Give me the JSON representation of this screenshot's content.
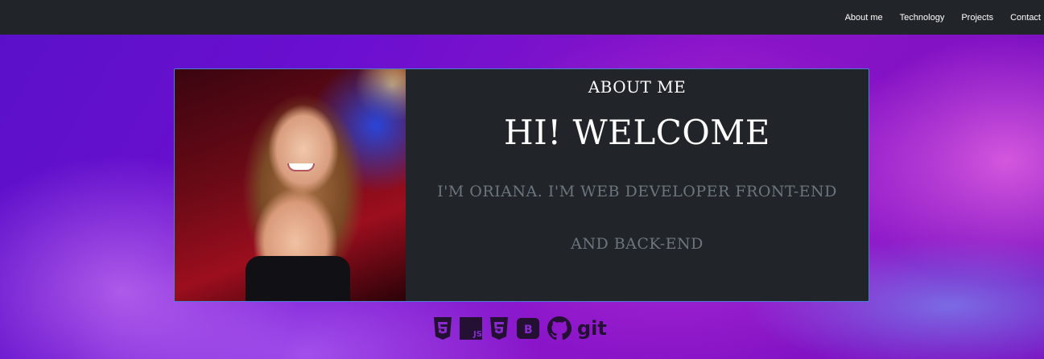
{
  "nav": {
    "items": [
      {
        "label": "About me"
      },
      {
        "label": "Technology"
      },
      {
        "label": "Projects"
      },
      {
        "label": "Contact"
      }
    ]
  },
  "about": {
    "section_title": "ABOUT ME",
    "greeting": "HI! WELCOME",
    "intro_line1": "I'M ORIANA. I'M WEB DEVELOPER FRONT-END",
    "intro_line2": "AND BACK-END"
  },
  "tech_icons": [
    "html5-icon",
    "javascript-icon",
    "css3-icon",
    "bootstrap-icon",
    "github-icon",
    "git-icon"
  ],
  "tech_git_label": "git",
  "colors": {
    "navbar": "#212529",
    "card": "#212529",
    "card_border": "#4a7fd4",
    "muted_text": "#6c757d",
    "icon": "#241033"
  }
}
